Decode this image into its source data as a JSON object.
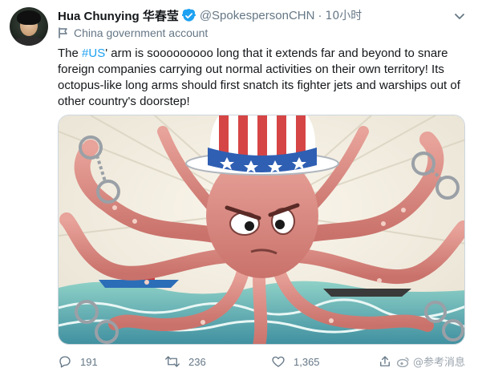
{
  "tweet": {
    "author_name": "Hua Chunying 华春莹",
    "handle": "@SpokespersonCHN",
    "separator": "·",
    "time": "10小时",
    "account_label": "China government account",
    "text_before_hashtag": "The ",
    "hashtag": "#US",
    "text_after_hashtag": "' arm is sooooooooo long that it extends far and beyond to snare foreign companies carrying out normal activities on their own territory! Its octopus-like long arms should first snatch its fighter jets and warships out of other country's doorstep!",
    "actions": {
      "replies": "191",
      "retweets": "236",
      "likes": "1,365"
    }
  },
  "watermark": "@参考消息",
  "colors": {
    "link": "#1da1f2",
    "verified": "#1da1f2",
    "secondary_text": "#657786",
    "like_heart": "#657786"
  },
  "icons": [
    "verified-badge-icon",
    "caret-down-icon",
    "government-flag-icon",
    "reply-icon",
    "retweet-icon",
    "like-icon",
    "share-icon",
    "weibo-icon"
  ]
}
